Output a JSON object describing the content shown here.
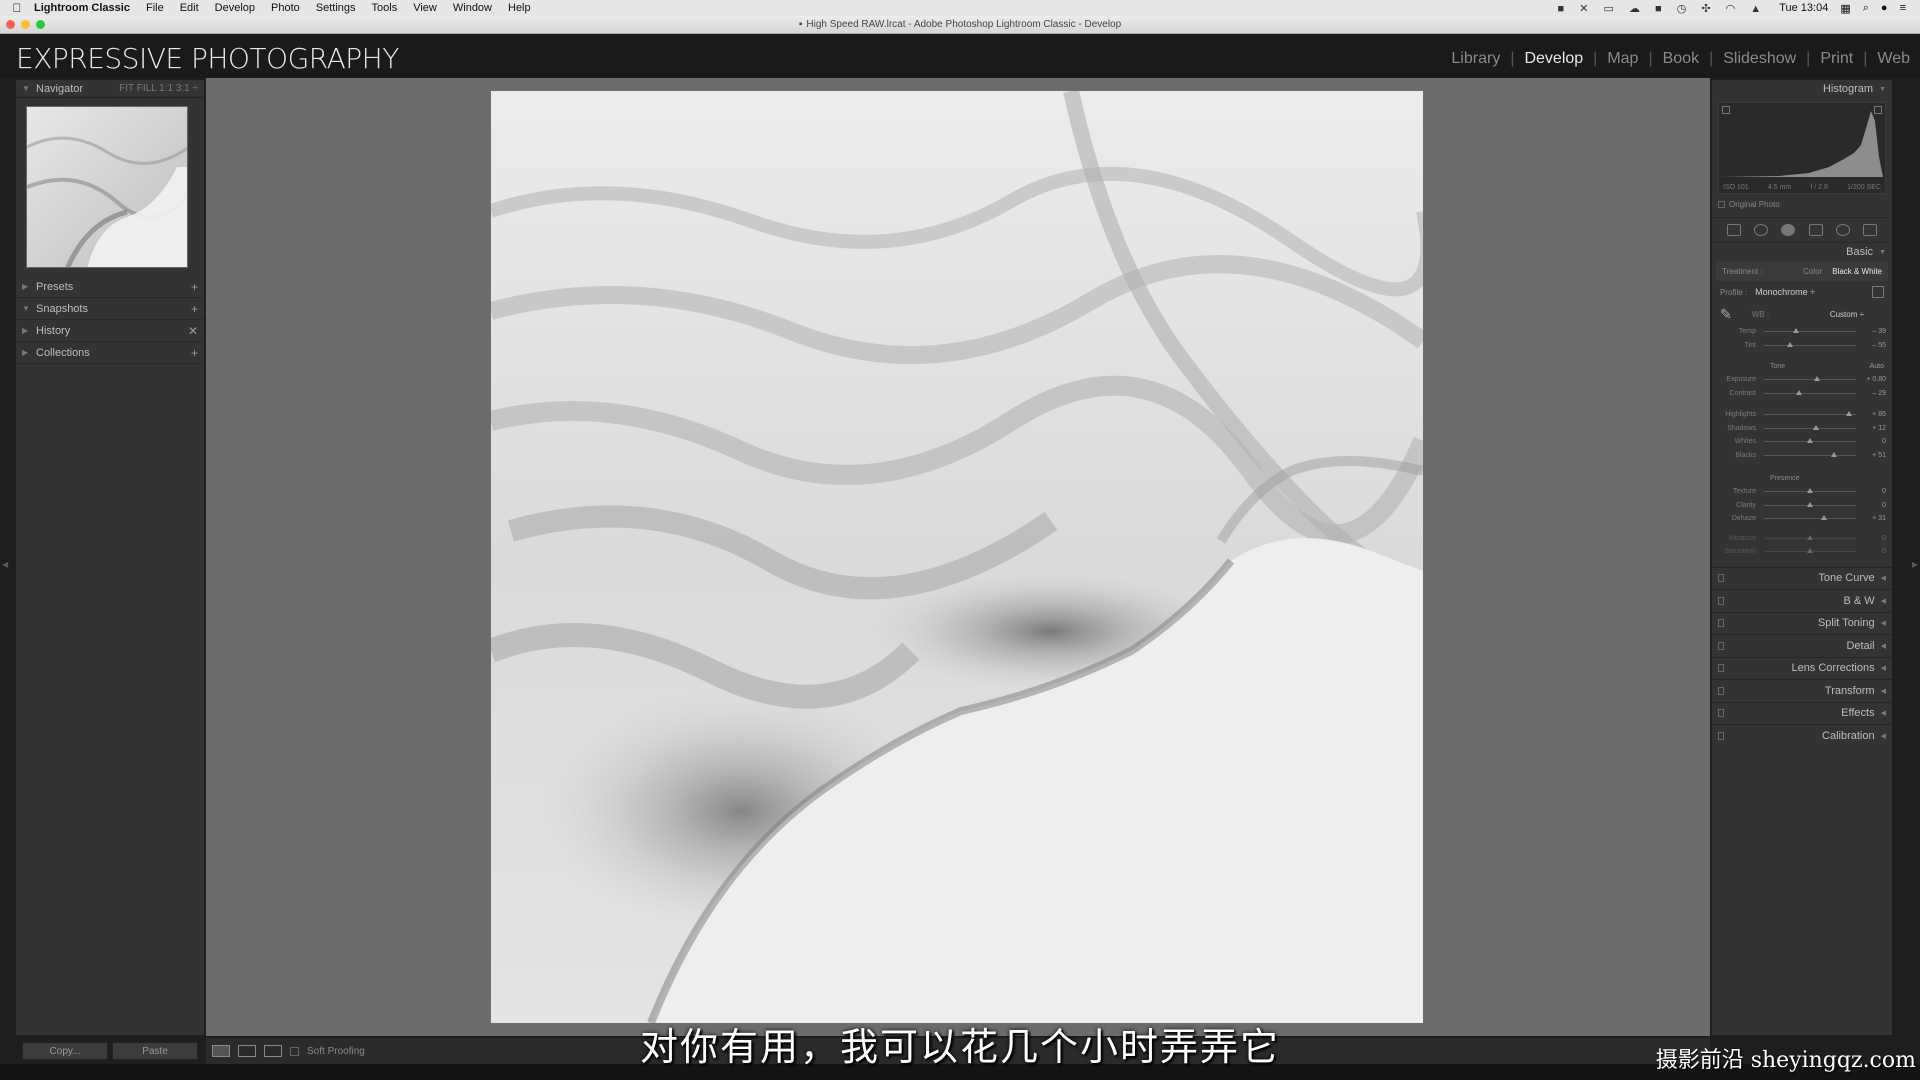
{
  "menubar": {
    "app_name": "Lightroom Classic",
    "items": [
      "File",
      "Edit",
      "Develop",
      "Photo",
      "Settings",
      "Tools",
      "View",
      "Window",
      "Help"
    ],
    "clock": "Tue 13:04"
  },
  "window": {
    "title": "High Speed RAW.lrcat - Adobe Photoshop Lightroom Classic - Develop"
  },
  "identity_plate": "EXPRESSIVE PHOTOGRAPHY",
  "modules": {
    "library": "Library",
    "develop": "Develop",
    "map": "Map",
    "book": "Book",
    "slideshow": "Slideshow",
    "print": "Print",
    "web": "Web",
    "active": "Develop"
  },
  "left_panel": {
    "navigator": {
      "title": "Navigator",
      "zoom_options": "FIT  FILL  1:1  3:1 ÷"
    },
    "presets": "Presets",
    "snapshots": "Snapshots",
    "history": "History",
    "collections": "Collections",
    "copy_label": "Copy...",
    "paste_label": "Paste"
  },
  "right_panel": {
    "histogram": {
      "title": "Histogram",
      "iso": "ISO 101",
      "focal": "4.5 mm",
      "aperture": "f / 2.8",
      "shutter": "1/200 SEC",
      "original_photo": "Original Photo"
    },
    "basic": {
      "title": "Basic",
      "treatment_label": "Treatment :",
      "treatment_color": "Color",
      "treatment_bw": "Black & White",
      "profile_label": "Profile :",
      "profile_value": "Monochrome ÷",
      "wb_label": "WB :",
      "wb_value": "Custom ÷",
      "tone_label": "Tone",
      "auto_label": "Auto",
      "presence_label": "Presence",
      "sliders": {
        "temp": {
          "label": "Temp",
          "value": "– 39",
          "pos": 0.35
        },
        "tint": {
          "label": "Tint",
          "value": "– 55",
          "pos": 0.28
        },
        "exposure": {
          "label": "Exposure",
          "value": "+ 0.80",
          "pos": 0.58
        },
        "contrast": {
          "label": "Contrast",
          "value": "– 29",
          "pos": 0.38
        },
        "highlights": {
          "label": "Highlights",
          "value": "+ 85",
          "pos": 0.92
        },
        "shadows": {
          "label": "Shadows",
          "value": "+ 12",
          "pos": 0.56
        },
        "whites": {
          "label": "Whites",
          "value": "0",
          "pos": 0.5
        },
        "blacks": {
          "label": "Blacks",
          "value": "+ 51",
          "pos": 0.76
        },
        "texture": {
          "label": "Texture",
          "value": "0",
          "pos": 0.5
        },
        "clarity": {
          "label": "Clarity",
          "value": "0",
          "pos": 0.5
        },
        "dehaze": {
          "label": "Dehaze",
          "value": "+ 31",
          "pos": 0.65
        },
        "vibrance": {
          "label": "Vibrance",
          "value": "0",
          "pos": 0.5
        },
        "saturation": {
          "label": "Saturation",
          "value": "0",
          "pos": 0.5
        }
      }
    },
    "collapsed_panels": [
      "Tone Curve",
      "B & W",
      "Split Toning",
      "Detail",
      "Lens Corrections",
      "Transform",
      "Effects",
      "Calibration"
    ]
  },
  "toolbar": {
    "soft_proofing": "Soft Proofing"
  },
  "overlay": {
    "subtitle": "对你有用，我可以花几个小时弄弄它",
    "watermark": "摄影前沿 sheyingqz.com"
  }
}
